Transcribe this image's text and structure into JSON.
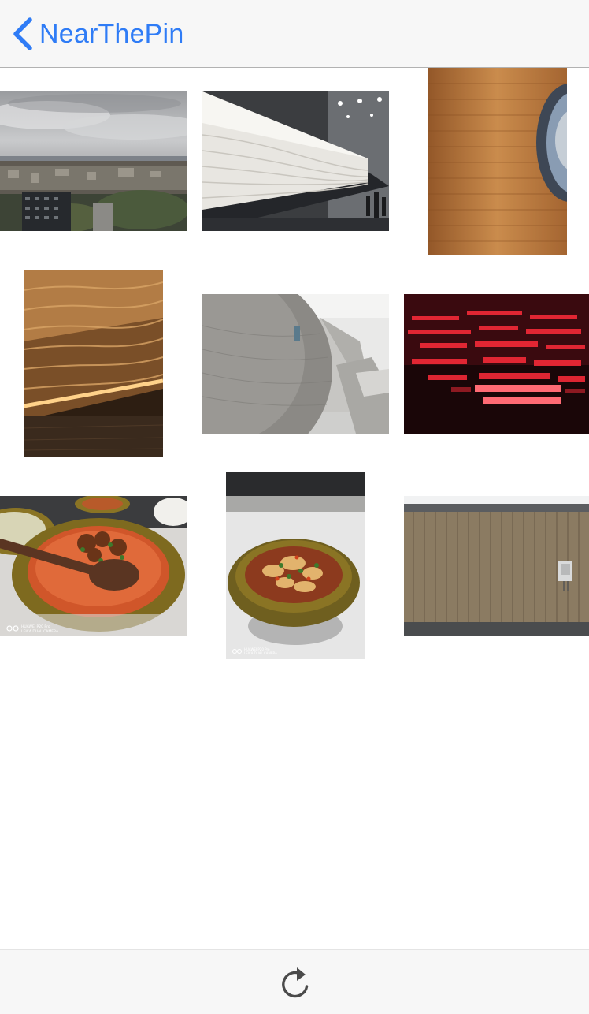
{
  "navbar": {
    "back_label": "NearThePin",
    "back_icon": "chevron-left-icon",
    "accent_color": "#2f7cf6"
  },
  "photos": [
    {
      "name": "photo-city-skyline",
      "subject": "city-skyline"
    },
    {
      "name": "photo-white-textured-wall",
      "subject": "white-textured-wall"
    },
    {
      "name": "photo-orange-tunnel",
      "subject": "orange-tunnel"
    },
    {
      "name": "photo-golden-textured-wall",
      "subject": "golden-textured-wall"
    },
    {
      "name": "photo-concrete-sphere",
      "subject": "concrete-sphere"
    },
    {
      "name": "photo-red-neon-text",
      "subject": "red-neon-text"
    },
    {
      "name": "photo-noodle-soup",
      "subject": "noodle-soup"
    },
    {
      "name": "photo-noodle-bowl",
      "subject": "noodle-bowl"
    },
    {
      "name": "photo-timber-building",
      "subject": "timber-building"
    }
  ],
  "watermarks": {
    "soup_line1": "HUAWEI P20 Pro",
    "soup_line2": "LEICA DUAL CAMERA",
    "bowl_line1": "HUAWEI P20 Pro",
    "bowl_line2": "LEICA DUAL CAMERA"
  },
  "toolbar": {
    "refresh_icon": "refresh-icon",
    "icon_color": "#4a4a4a"
  }
}
